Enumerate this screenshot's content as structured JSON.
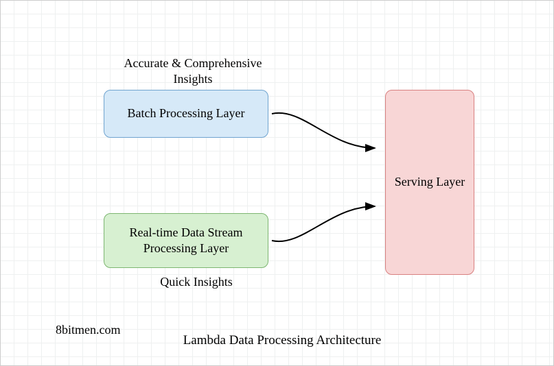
{
  "labels": {
    "accurate": "Accurate & Comprehensive Insights",
    "quick": "Quick Insights"
  },
  "boxes": {
    "batch": "Batch Processing Layer",
    "realtime": "Real-time Data Stream Processing Layer",
    "serving": "Serving Layer"
  },
  "title": "Lambda Data Processing Architecture",
  "watermark": "8bitmen.com"
}
